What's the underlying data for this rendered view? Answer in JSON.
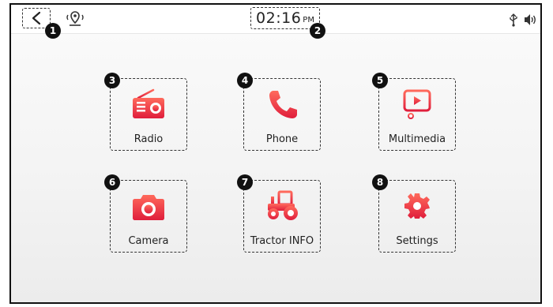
{
  "statusbar": {
    "time": "02:16",
    "ampm": "PM",
    "back_icon": "chevron-left-icon",
    "gps_icon": "gps-signal-icon",
    "usb_icon": "usb-icon",
    "volume_icon": "volume-icon"
  },
  "tiles": [
    {
      "label": "Radio",
      "icon": "radio-icon"
    },
    {
      "label": "Phone",
      "icon": "phone-icon"
    },
    {
      "label": "Multimedia",
      "icon": "multimedia-icon"
    },
    {
      "label": "Camera",
      "icon": "camera-icon"
    },
    {
      "label": "Tractor INFO",
      "icon": "tractor-icon"
    },
    {
      "label": "Settings",
      "icon": "gear-icon"
    }
  ],
  "callouts": [
    "1",
    "2",
    "3",
    "4",
    "5",
    "6",
    "7",
    "8"
  ],
  "colors": {
    "accent": "#e8323c",
    "accent_light": "#ff5a5a"
  }
}
